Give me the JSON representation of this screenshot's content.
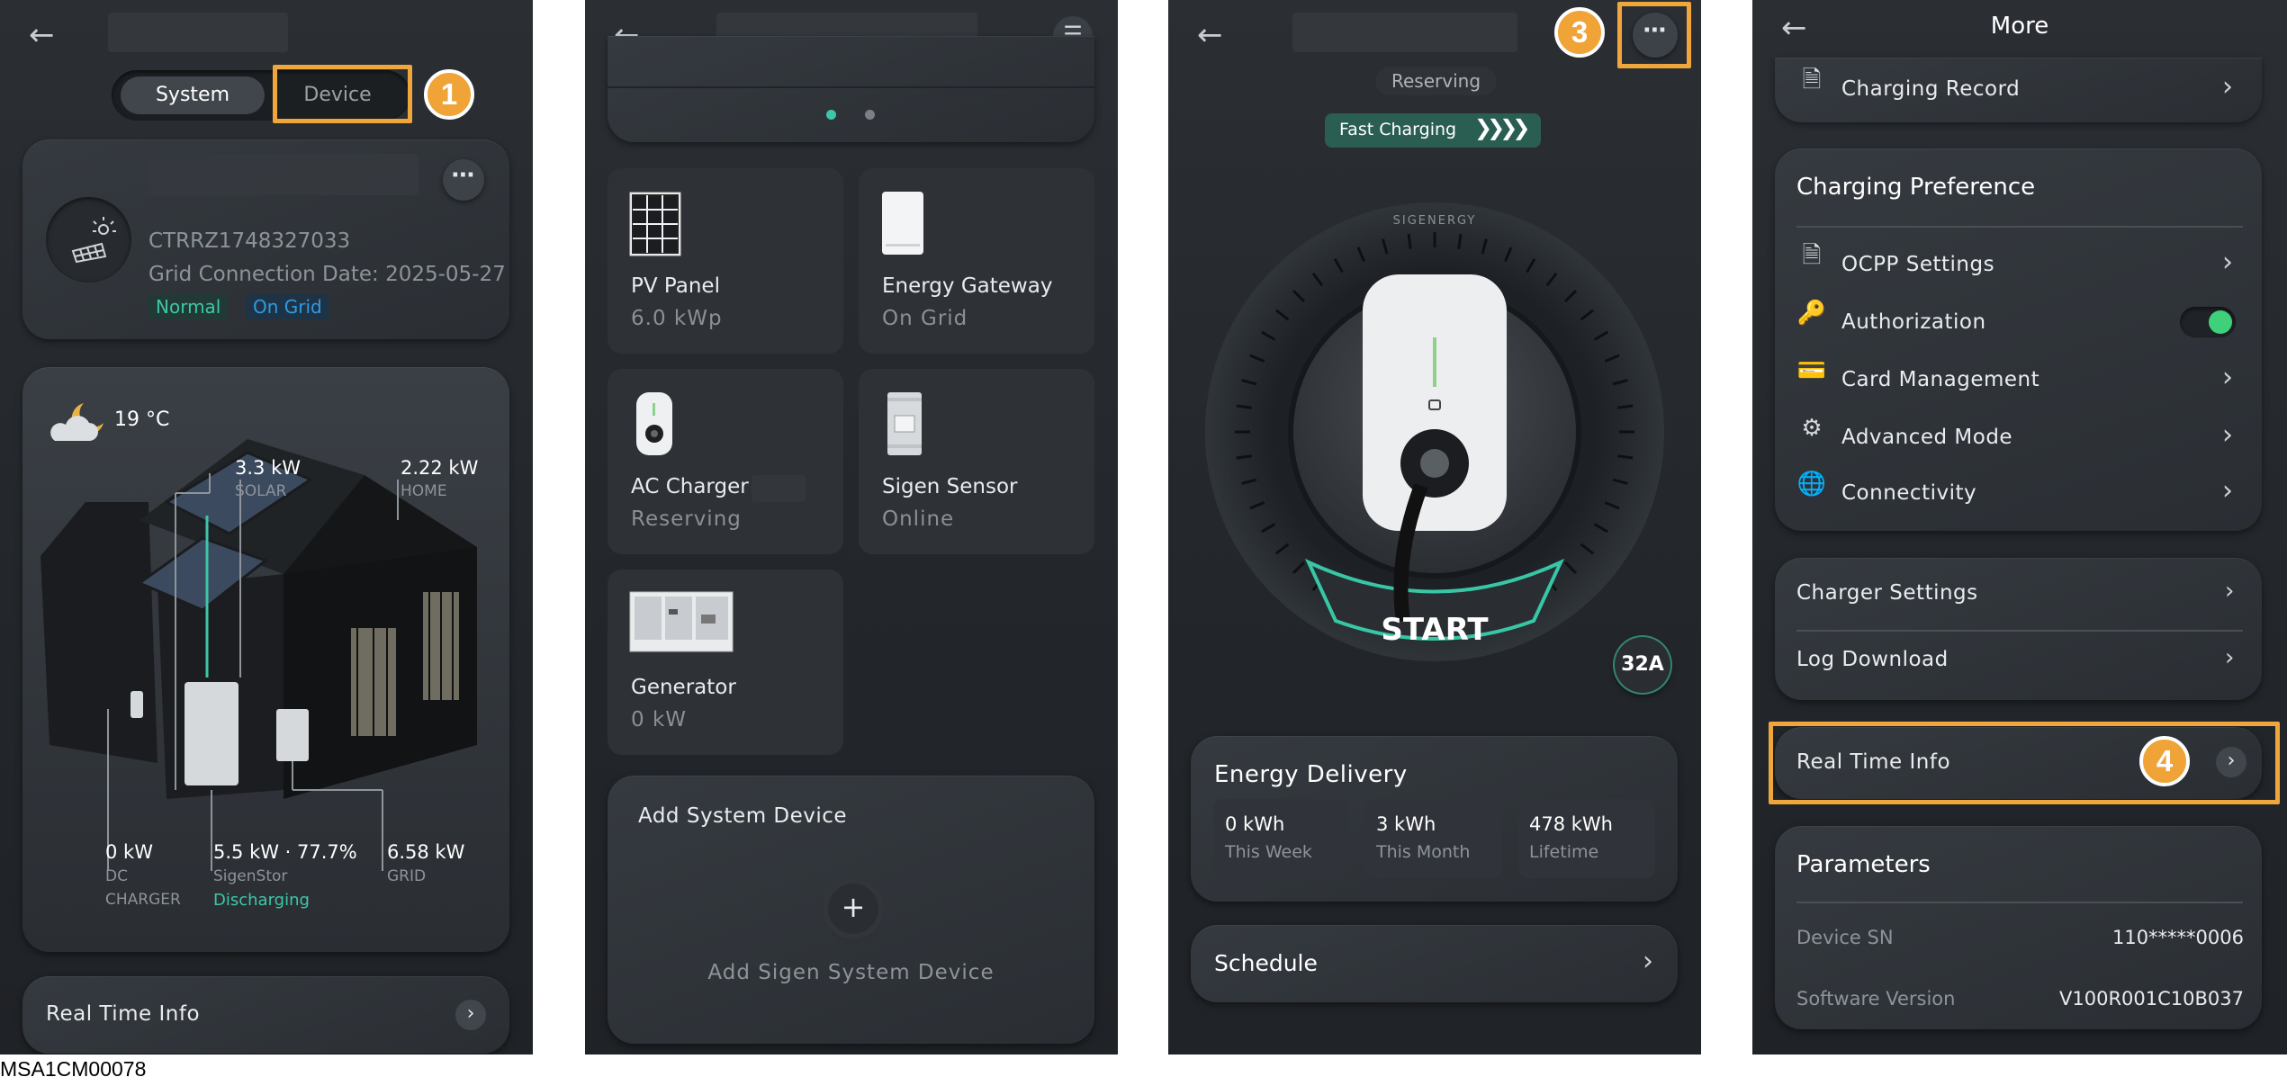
{
  "screen1": {
    "tabs": {
      "system": "System",
      "device": "Device"
    },
    "step": "1",
    "site": {
      "serial": "CTRRZ1748327033",
      "grid_date": "Grid Connection Date: 2025-05-27",
      "badge_normal": "Normal",
      "badge_ongrid": "On Grid"
    },
    "weather": {
      "temp": "19 °C"
    },
    "flows": {
      "solar": {
        "value": "3.3 kW",
        "label": "SOLAR"
      },
      "home": {
        "value": "2.22 kW",
        "label": "HOME"
      },
      "dc": {
        "value": "0 kW",
        "label1": "DC",
        "label2": "CHARGER"
      },
      "sigenstor": {
        "value": "5.5 kW · 77.7%",
        "label": "SigenStor",
        "status": "Discharging"
      },
      "grid": {
        "value": "6.58 kW",
        "label": "GRID"
      }
    },
    "realtime": "Real Time Info"
  },
  "screen2": {
    "step": "2",
    "devices": [
      {
        "name": "PV Panel",
        "value": "6.0 kWp"
      },
      {
        "name": "Energy Gateway",
        "value": "On Grid"
      },
      {
        "name": "AC Charger",
        "value": "Reserving"
      },
      {
        "name": "Sigen Sensor",
        "value": "Online"
      },
      {
        "name": "Generator",
        "value": "0 kW"
      }
    ],
    "add": {
      "title": "Add System Device",
      "button": "Add Sigen System Device",
      "plus": "+"
    }
  },
  "screen3": {
    "step": "3",
    "status": "Reserving",
    "mode": "Fast Charging",
    "brand": "SIGENERGY",
    "start": "START",
    "current": "32A",
    "energy": {
      "title": "Energy Delivery",
      "items": [
        {
          "value": "0 kWh",
          "label": "This Week"
        },
        {
          "value": "3 kWh",
          "label": "This Month"
        },
        {
          "value": "478 kWh",
          "label": "Lifetime"
        }
      ]
    },
    "schedule": "Schedule"
  },
  "screen4": {
    "title": "More",
    "step": "4",
    "charging_record": "Charging Record",
    "preference": {
      "title": "Charging Preference",
      "items": [
        "OCPP Settings",
        "Authorization",
        "Card Management",
        "Advanced Mode",
        "Connectivity"
      ]
    },
    "charger_settings": "Charger Settings",
    "log_download": "Log Download",
    "realtime": "Real Time Info",
    "params": {
      "title": "Parameters",
      "sn_label": "Device SN",
      "sn_value": "110*****0006",
      "sw_label": "Software Version",
      "sw_value": "V100R001C10B037"
    }
  },
  "caption": "MSA1CM00078",
  "colors": {
    "accent": "#f0a337",
    "teal": "#3ec6a8",
    "blue": "#2f9be0",
    "switch": "#3fd07a"
  }
}
